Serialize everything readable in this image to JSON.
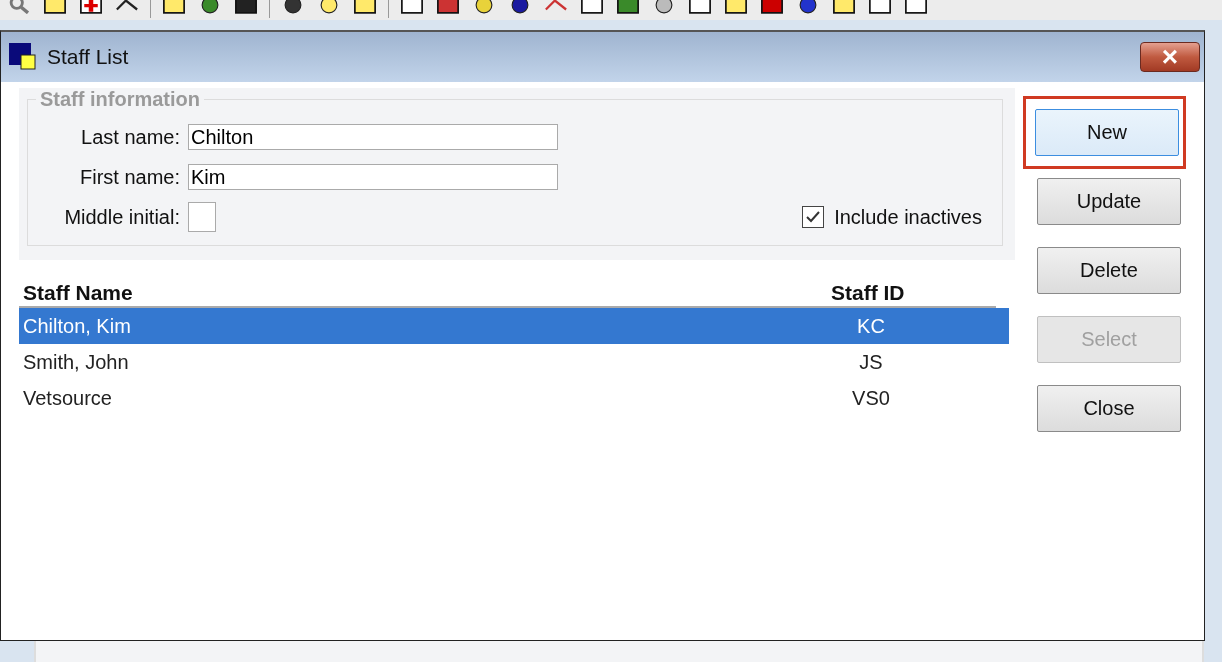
{
  "window": {
    "title": "Staff List",
    "close_label": "×"
  },
  "staff_information": {
    "legend": "Staff information",
    "fields": [
      {
        "label": "Last name:",
        "value": "Chilton",
        "kind": "text"
      },
      {
        "label": "First name:",
        "value": "Kim",
        "kind": "text"
      },
      {
        "label": "Middle initial:",
        "kind": "initial"
      }
    ],
    "include_inactives": {
      "label": "Include inactives",
      "checked": true
    }
  },
  "table": {
    "columns": [
      "Staff Name",
      "Staff ID"
    ],
    "rows": [
      {
        "cells": [
          "Chilton, Kim",
          "KC"
        ],
        "selected": true
      },
      {
        "cells": [
          "Smith, John",
          "JS"
        ],
        "selected": false
      },
      {
        "cells": [
          "Vetsource",
          "VS0"
        ],
        "selected": false
      }
    ]
  },
  "buttons": [
    {
      "label": "New",
      "disabled": false,
      "highlighted": true
    },
    {
      "label": "Update",
      "disabled": false,
      "highlighted": false
    },
    {
      "label": "Delete",
      "disabled": false,
      "highlighted": false
    },
    {
      "label": "Select",
      "disabled": true,
      "highlighted": false
    },
    {
      "label": "Close",
      "disabled": false,
      "highlighted": false
    }
  ]
}
